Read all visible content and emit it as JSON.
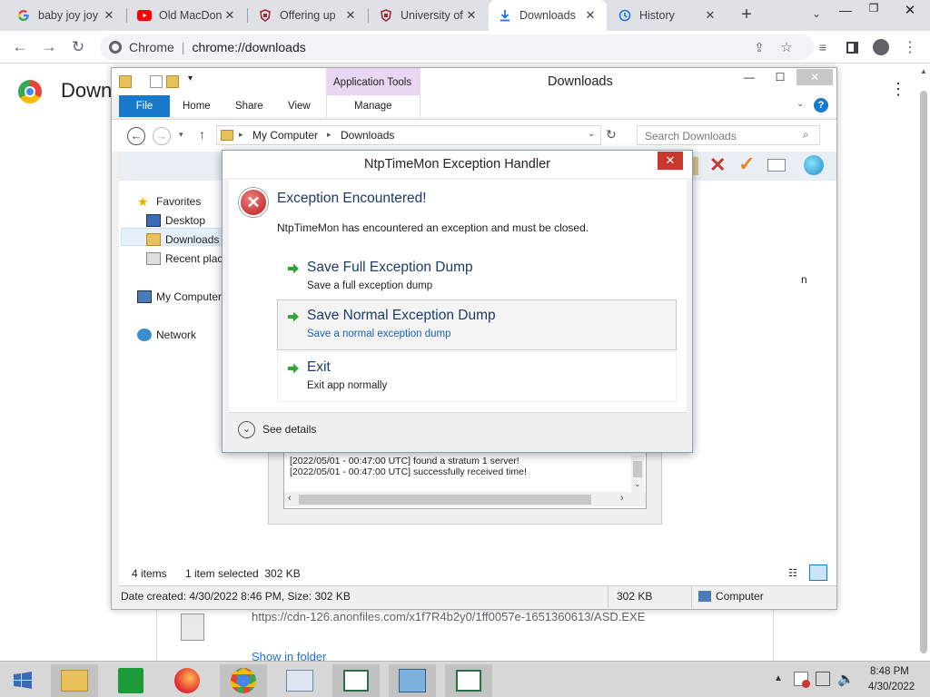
{
  "browser": {
    "tabs": [
      {
        "label": "baby joy joy",
        "icon": "google-icon"
      },
      {
        "label": "Old MacDon",
        "icon": "youtube-icon"
      },
      {
        "label": "Offering up",
        "icon": "university-logo-icon"
      },
      {
        "label": "University of",
        "icon": "university-logo-icon"
      },
      {
        "label": "Downloads",
        "icon": "download-icon"
      },
      {
        "label": "History",
        "icon": "history-icon"
      }
    ],
    "omnibox_site": "Chrome",
    "omnibox_url": "chrome://downloads",
    "page_heading": "Down"
  },
  "downloads_item": {
    "url": "https://cdn-126.anonfiles.com/x1f7R4b2y0/1ff0057e-1651360613/ASD.EXE",
    "show_in_folder": "Show in folder"
  },
  "explorer": {
    "title": "Downloads",
    "context_tab": "Application Tools",
    "ribbon_tabs": [
      "File",
      "Home",
      "Share",
      "View",
      "Manage"
    ],
    "breadcrumb": [
      "My Computer",
      "Downloads"
    ],
    "search_placeholder": "Search Downloads",
    "nav": {
      "favorites": "Favorites",
      "desktop": "Desktop",
      "downloads": "Downloads",
      "recent": "Recent plac",
      "computer": "My Computer",
      "network": "Network"
    },
    "right_fragment": "n",
    "status_items": "4 items",
    "status_selected": "1 item selected  302 KB",
    "details_created": "Date created: 4/30/2022 8:46 PM, Size: 302 KB",
    "details_size": "302 KB",
    "details_location": "Computer"
  },
  "log": {
    "lines": [
      "[2022/05/01 - 00:47:00 UTC] found a stratum 1 server!",
      "[2022/05/01 - 00:47:00 UTC] successfully received time!"
    ]
  },
  "dialog": {
    "title": "NtpTimeMon Exception Handler",
    "heading": "Exception Encountered!",
    "message": "NtpTimeMon has encountered an exception and must be closed.",
    "options": [
      {
        "title": "Save Full Exception Dump",
        "subtitle": "Save a full exception dump"
      },
      {
        "title": "Save Normal Exception Dump",
        "subtitle": "Save a normal exception dump"
      },
      {
        "title": "Exit",
        "subtitle": "Exit app normally"
      }
    ],
    "details": "See details"
  },
  "taskbar": {
    "time": "8:48 PM",
    "date": "4/30/2022"
  },
  "colors": {
    "accent_blue": "#1979ca",
    "context_purple": "#e9d6f2",
    "error_red": "#c7382f",
    "option_title": "#1d3b68"
  }
}
